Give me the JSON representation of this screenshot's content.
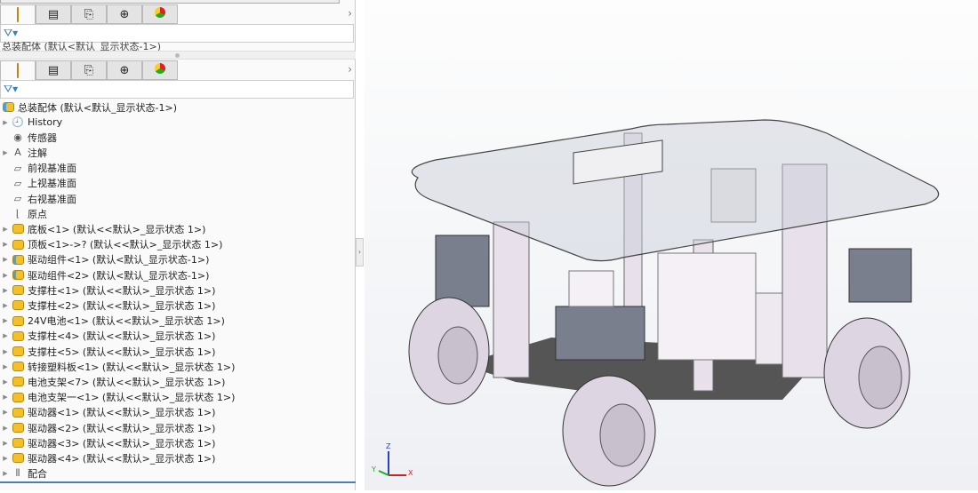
{
  "panel_tabs": [
    {
      "icon": "feature-manager-icon"
    },
    {
      "icon": "property-manager-icon"
    },
    {
      "icon": "configuration-manager-icon"
    },
    {
      "icon": "dimxpert-icon"
    },
    {
      "icon": "display-manager-icon"
    }
  ],
  "top_clipped_row": "总装配体 (默认<默认_显示状态-1>)",
  "filter_icon": "filter-icon",
  "tree": {
    "root": "总装配体 (默认<默认_显示状态-1>)",
    "items": [
      {
        "label": "History",
        "icon": "history-icon",
        "expand": true
      },
      {
        "label": "传感器",
        "icon": "sensor-icon",
        "expand": false
      },
      {
        "label": "注解",
        "icon": "annotation-icon",
        "expand": true
      },
      {
        "label": "前视基准面",
        "icon": "plane-icon",
        "expand": false
      },
      {
        "label": "上视基准面",
        "icon": "plane-icon",
        "expand": false
      },
      {
        "label": "右视基准面",
        "icon": "plane-icon",
        "expand": false
      },
      {
        "label": "原点",
        "icon": "origin-icon",
        "expand": false
      },
      {
        "label": "底板<1> (默认<<默认>_显示状态 1>)",
        "icon": "part-icon",
        "expand": true
      },
      {
        "label": "顶板<1>->? (默认<<默认>_显示状态 1>)",
        "icon": "part-icon",
        "expand": true
      },
      {
        "label": "驱动组件<1> (默认<默认_显示状态-1>)",
        "icon": "subassembly-icon",
        "expand": true
      },
      {
        "label": "驱动组件<2> (默认<默认_显示状态-1>)",
        "icon": "subassembly-icon",
        "expand": true
      },
      {
        "label": "支撑柱<1> (默认<<默认>_显示状态 1>)",
        "icon": "part-icon",
        "expand": true
      },
      {
        "label": "支撑柱<2> (默认<<默认>_显示状态 1>)",
        "icon": "part-icon",
        "expand": true
      },
      {
        "label": "24V电池<1> (默认<<默认>_显示状态 1>)",
        "icon": "part-icon",
        "expand": true
      },
      {
        "label": "支撑柱<4> (默认<<默认>_显示状态 1>)",
        "icon": "part-icon",
        "expand": true
      },
      {
        "label": "支撑柱<5> (默认<<默认>_显示状态 1>)",
        "icon": "part-icon",
        "expand": true
      },
      {
        "label": "转接塑料板<1> (默认<<默认>_显示状态 1>)",
        "icon": "part-icon",
        "expand": true
      },
      {
        "label": "电池支架<7> (默认<<默认>_显示状态 1>)",
        "icon": "part-icon",
        "expand": true
      },
      {
        "label": "电池支架一<1> (默认<<默认>_显示状态 1>)",
        "icon": "part-icon",
        "expand": true
      },
      {
        "label": "驱动器<1> (默认<<默认>_显示状态 1>)",
        "icon": "part-icon",
        "expand": true
      },
      {
        "label": "驱动器<2> (默认<<默认>_显示状态 1>)",
        "icon": "part-icon",
        "expand": true
      },
      {
        "label": "驱动器<3> (默认<<默认>_显示状态 1>)",
        "icon": "part-icon",
        "expand": true
      },
      {
        "label": "驱动器<4> (默认<<默认>_显示状态 1>)",
        "icon": "part-icon",
        "expand": true
      },
      {
        "label": "配合",
        "icon": "mates-icon",
        "expand": true
      }
    ]
  },
  "triad": {
    "x": "X",
    "y": "Y",
    "z": "Z"
  }
}
